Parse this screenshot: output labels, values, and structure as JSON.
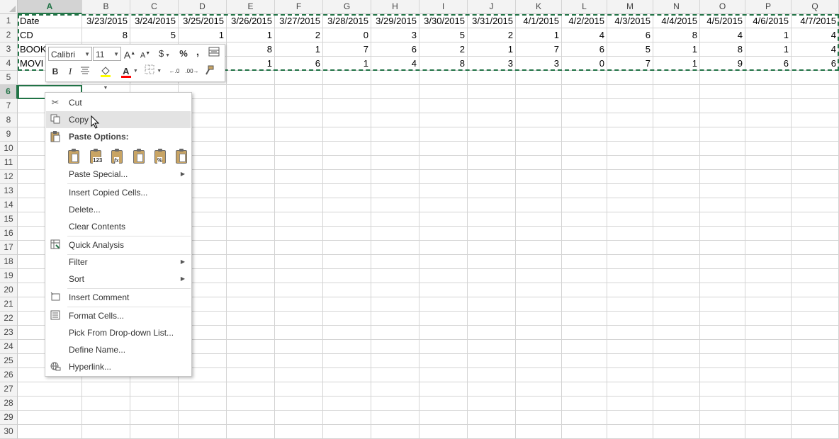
{
  "columns": [
    "A",
    "B",
    "C",
    "D",
    "E",
    "F",
    "G",
    "H",
    "I",
    "J",
    "K",
    "L",
    "M",
    "N",
    "O",
    "P",
    "Q"
  ],
  "rows": [
    "1",
    "2",
    "3",
    "4",
    "5",
    "6",
    "7",
    "8",
    "9",
    "10",
    "11",
    "12",
    "13",
    "14",
    "15",
    "16",
    "17",
    "18",
    "19",
    "20",
    "21",
    "22",
    "23",
    "24",
    "25",
    "26",
    "27",
    "28",
    "29",
    "30"
  ],
  "selected_column": "A",
  "selected_row": "6",
  "cells": {
    "row1": [
      "Date",
      "3/23/2015",
      "3/24/2015",
      "3/25/2015",
      "3/26/2015",
      "3/27/2015",
      "3/28/2015",
      "3/29/2015",
      "3/30/2015",
      "3/31/2015",
      "4/1/2015",
      "4/2/2015",
      "4/3/2015",
      "4/4/2015",
      "4/5/2015",
      "4/6/2015",
      "4/7/2015"
    ],
    "row2": [
      "CD",
      "8",
      "5",
      "1",
      "1",
      "2",
      "0",
      "3",
      "5",
      "2",
      "1",
      "4",
      "6",
      "8",
      "4",
      "1",
      "4"
    ],
    "row3": [
      "BOOK",
      "",
      "",
      "",
      "8",
      "1",
      "7",
      "6",
      "2",
      "1",
      "7",
      "6",
      "5",
      "1",
      "8",
      "1",
      "4"
    ],
    "row4": [
      "MOVI",
      "",
      "",
      "",
      "1",
      "6",
      "1",
      "4",
      "8",
      "3",
      "3",
      "0",
      "7",
      "1",
      "9",
      "6",
      "6"
    ]
  },
  "mini_toolbar": {
    "font_name": "Calibri",
    "font_size": "11",
    "grow_font": "A",
    "shrink_font": "A",
    "currency": "$",
    "percent": "%",
    "comma": ",",
    "bold": "B",
    "italic": "I",
    "font_color_letter": "A",
    "increase_decimal": "←.0",
    "decrease_decimal": ".00→",
    "font_color": "#ff0000",
    "highlight_color": "#ffff00"
  },
  "context_menu": {
    "cut": "Cut",
    "copy": "Copy",
    "paste_options": "Paste Options:",
    "paste_values_tag": "123",
    "paste_formulas_tag": "fx",
    "paste_percent_tag": "%",
    "paste_special": "Paste Special...",
    "insert_copied_cells": "Insert Copied Cells...",
    "delete": "Delete...",
    "clear_contents": "Clear Contents",
    "quick_analysis": "Quick Analysis",
    "filter": "Filter",
    "sort": "Sort",
    "insert_comment": "Insert Comment",
    "format_cells": "Format Cells...",
    "pick_from_list": "Pick From Drop-down List...",
    "define_name": "Define Name...",
    "hyperlink": "Hyperlink..."
  },
  "colors": {
    "excel_green": "#217346",
    "header_bg": "#f3f3f3",
    "menu_highlight": "#e3e3e3"
  }
}
